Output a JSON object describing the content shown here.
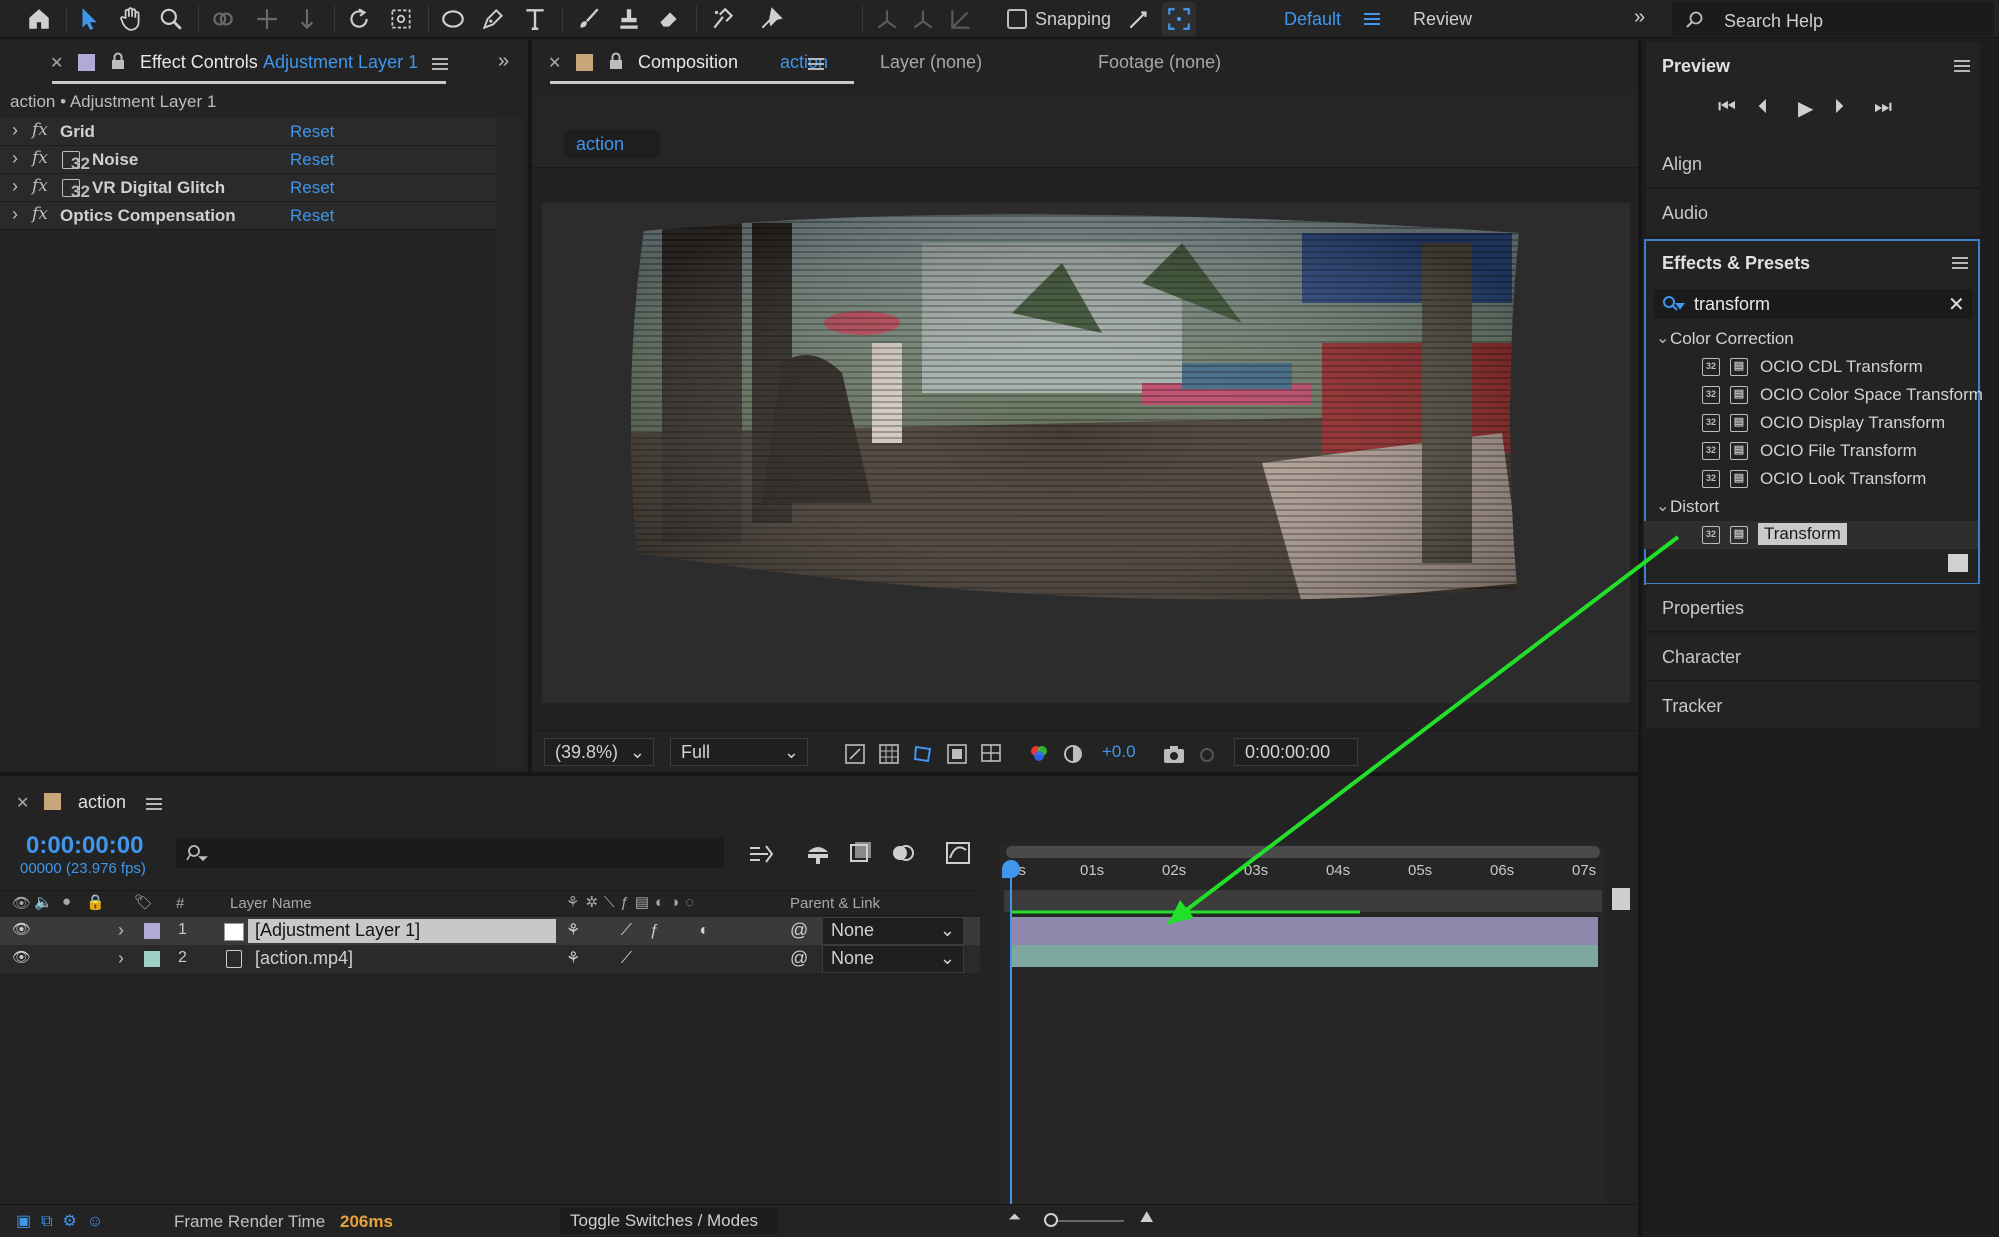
{
  "toolbar": {
    "snapping_label": "Snapping",
    "workspace_default": "Default",
    "workspace_review": "Review",
    "search_placeholder": "Search Help"
  },
  "effect_controls": {
    "tab_label": "Effect Controls",
    "tab_layer": "Adjustment Layer 1",
    "breadcrumb": "action • Adjustment Layer 1",
    "effects": [
      {
        "name": "Grid",
        "reset": "Reset"
      },
      {
        "name": "Noise",
        "reset": "Reset"
      },
      {
        "name": "VR Digital Glitch",
        "reset": "Reset"
      },
      {
        "name": "Optics Compensation",
        "reset": "Reset"
      }
    ]
  },
  "composition": {
    "tab_label": "Composition",
    "tab_name": "action",
    "layer_tab": "Layer (none)",
    "footage_tab": "Footage (none)",
    "comp_chip": "action",
    "zoom": "(39.8%)",
    "resolution": "Full",
    "exposure": "+0.0",
    "timecode": "0:00:00:00"
  },
  "right_panel": {
    "preview": "Preview",
    "align": "Align",
    "audio": "Audio",
    "effects_presets": "Effects & Presets",
    "search_value": "transform",
    "groups": [
      {
        "name": "Color Correction",
        "items": [
          "OCIO CDL Transform",
          "OCIO Color Space Transform",
          "OCIO Display Transform",
          "OCIO File Transform",
          "OCIO Look Transform"
        ]
      },
      {
        "name": "Distort",
        "items": [
          "Transform"
        ]
      }
    ],
    "icon_badge": "32",
    "properties": "Properties",
    "character": "Character",
    "tracker": "Tracker"
  },
  "timeline": {
    "tab_name": "action",
    "timecode": "0:00:00:00",
    "frames_fps": "00000 (23.976 fps)",
    "col_number": "#",
    "col_layer_name": "Layer Name",
    "col_parent": "Parent & Link",
    "ruler": [
      "0s",
      "01s",
      "02s",
      "03s",
      "04s",
      "05s",
      "06s",
      "07s"
    ],
    "layers": [
      {
        "num": "1",
        "name": "[Adjustment Layer 1]",
        "parent": "None",
        "color": "#b3a9d9"
      },
      {
        "num": "2",
        "name": "[action.mp4]",
        "parent": "None",
        "color": "#9fd0c4"
      }
    ],
    "frame_render_label": "Frame Render Time",
    "frame_render_value": "206ms",
    "toggle_label": "Toggle Switches / Modes"
  },
  "colors": {
    "accent": "#3f96ec",
    "arrow": "#22e02a",
    "panel": "#232323",
    "frame_render": "#e8a03c"
  }
}
